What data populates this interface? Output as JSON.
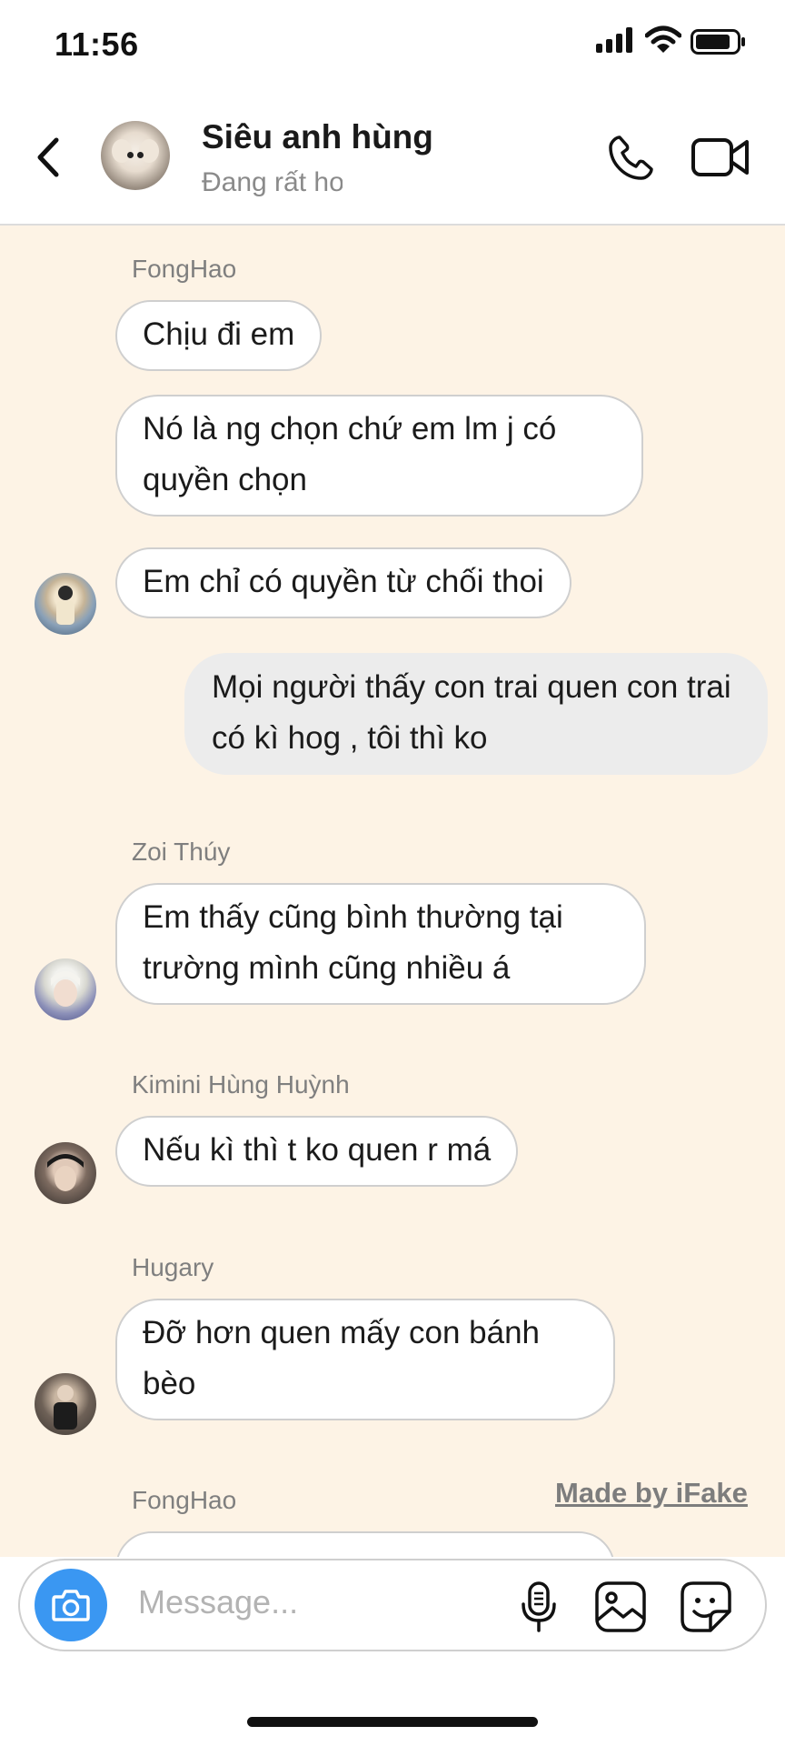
{
  "status_bar": {
    "time": "11:56"
  },
  "header": {
    "title": "Siêu anh hùng",
    "subtitle": "Đang rất hoạt động",
    "back_icon": "chevron-left-icon",
    "call_icon": "phone-icon",
    "video_icon": "video-camera-icon"
  },
  "messages": [
    {
      "sender": "FongHao",
      "texts": [
        "Chịu đi em",
        "Nó là ng chọn chứ em lm j có quyền chọn",
        "Em chỉ có quyền từ chối thoi"
      ]
    },
    {
      "outgoing": "Mọi người thấy con trai quen con trai có kì hog , tôi thì ko"
    },
    {
      "sender": "Zoi Thúy",
      "texts": [
        "Em thấy cũng bình thường tại trường mình cũng nhiều á"
      ]
    },
    {
      "sender": "Kimini Hùng Huỳnh",
      "texts": [
        "Nếu kì thì t ko quen r má"
      ]
    },
    {
      "sender": "Hugary",
      "texts": [
        "Đỡ hơn quen mấy con bánh bèo"
      ]
    },
    {
      "sender": "FongHao",
      "texts": []
    }
  ],
  "watermark": "Made by iFake",
  "composer": {
    "placeholder": "Message...",
    "camera_icon": "camera-icon",
    "mic_icon": "microphone-icon",
    "gallery_icon": "image-icon",
    "sticker_icon": "sticker-icon"
  },
  "colors": {
    "chat_background": "#fdf3e5",
    "camera_button": "#3a97f2",
    "outgoing_bubble": "#ececec"
  }
}
